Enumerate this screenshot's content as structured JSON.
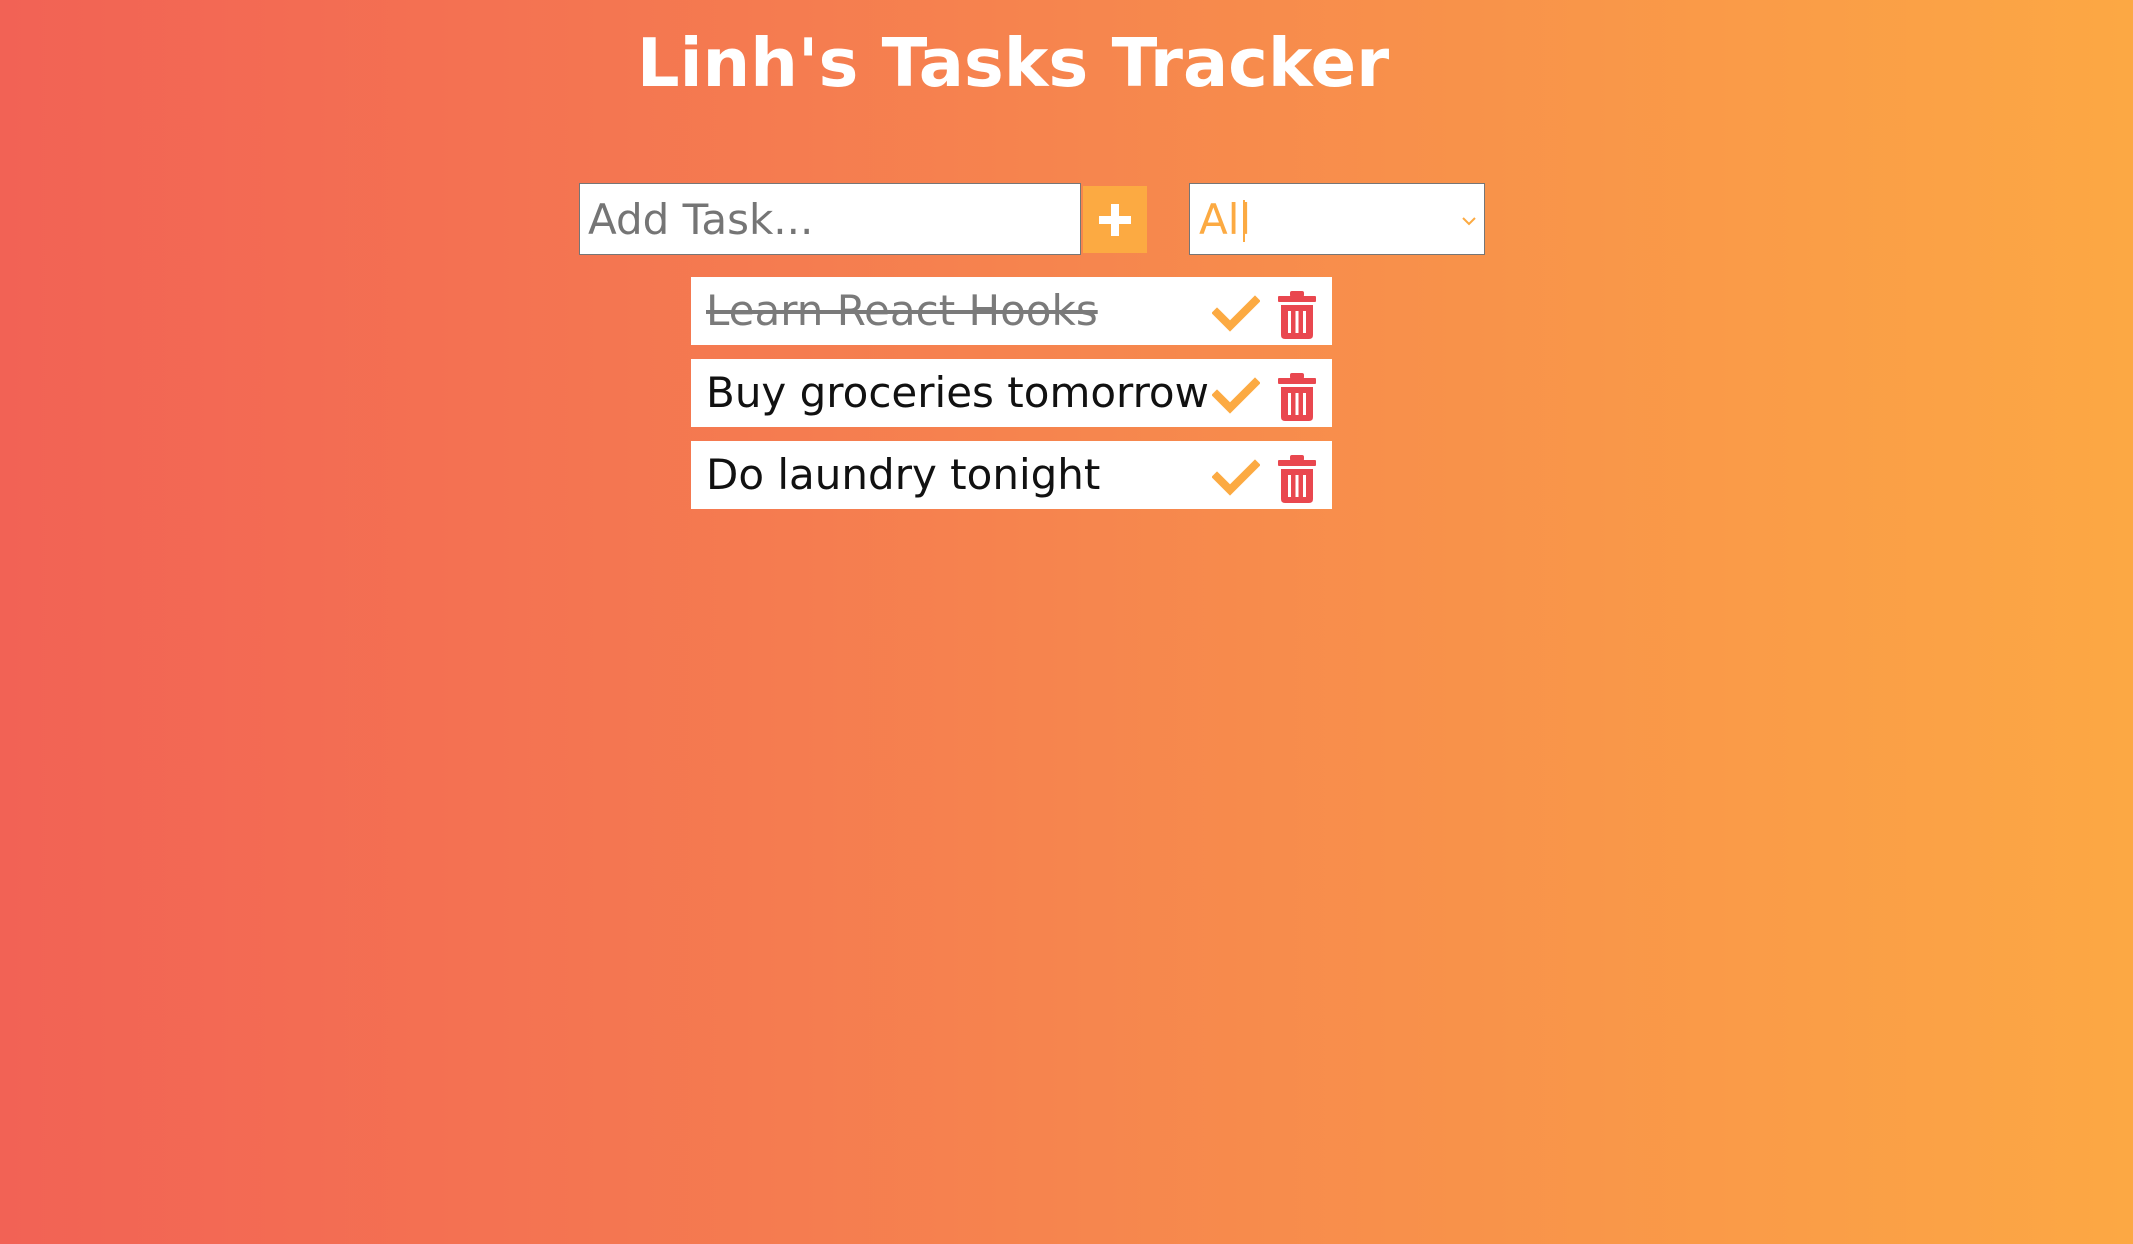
{
  "app": {
    "title": "Linh's Tasks Tracker"
  },
  "form": {
    "input_value": "",
    "input_placeholder": "Add Task...",
    "add_icon": "plus-icon",
    "filter": {
      "selected": "All",
      "icon": "chevron-down-icon"
    }
  },
  "todos": [
    {
      "text": "Learn React Hooks",
      "completed": true
    },
    {
      "text": "Buy groceries tomorrow",
      "completed": false
    },
    {
      "text": "Do laundry tonight",
      "completed": false
    }
  ],
  "colors": {
    "gradient_start": "#f26255",
    "gradient_end": "#fca844",
    "accent": "#fcaa42",
    "delete": "#e9474f"
  },
  "icons": {
    "complete": "check-icon",
    "delete": "trash-icon"
  }
}
